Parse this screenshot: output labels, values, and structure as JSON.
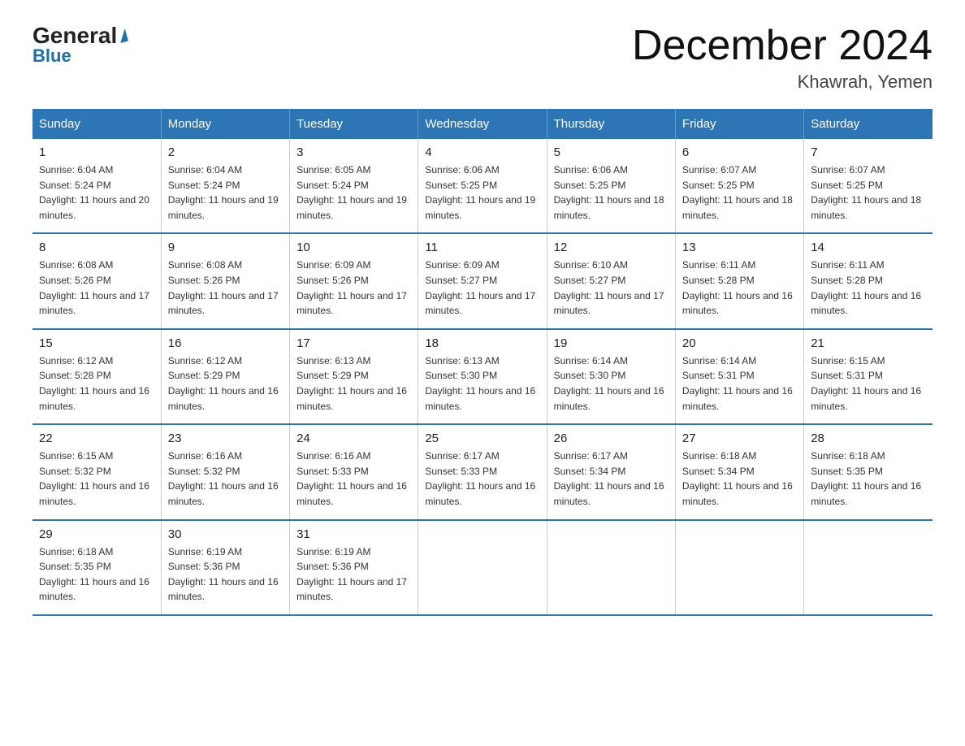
{
  "logo": {
    "general": "General",
    "blue": "Blue"
  },
  "header": {
    "title": "December 2024",
    "location": "Khawrah, Yemen"
  },
  "days_of_week": [
    "Sunday",
    "Monday",
    "Tuesday",
    "Wednesday",
    "Thursday",
    "Friday",
    "Saturday"
  ],
  "weeks": [
    [
      {
        "day": "1",
        "sunrise": "6:04 AM",
        "sunset": "5:24 PM",
        "daylight": "11 hours and 20 minutes."
      },
      {
        "day": "2",
        "sunrise": "6:04 AM",
        "sunset": "5:24 PM",
        "daylight": "11 hours and 19 minutes."
      },
      {
        "day": "3",
        "sunrise": "6:05 AM",
        "sunset": "5:24 PM",
        "daylight": "11 hours and 19 minutes."
      },
      {
        "day": "4",
        "sunrise": "6:06 AM",
        "sunset": "5:25 PM",
        "daylight": "11 hours and 19 minutes."
      },
      {
        "day": "5",
        "sunrise": "6:06 AM",
        "sunset": "5:25 PM",
        "daylight": "11 hours and 18 minutes."
      },
      {
        "day": "6",
        "sunrise": "6:07 AM",
        "sunset": "5:25 PM",
        "daylight": "11 hours and 18 minutes."
      },
      {
        "day": "7",
        "sunrise": "6:07 AM",
        "sunset": "5:25 PM",
        "daylight": "11 hours and 18 minutes."
      }
    ],
    [
      {
        "day": "8",
        "sunrise": "6:08 AM",
        "sunset": "5:26 PM",
        "daylight": "11 hours and 17 minutes."
      },
      {
        "day": "9",
        "sunrise": "6:08 AM",
        "sunset": "5:26 PM",
        "daylight": "11 hours and 17 minutes."
      },
      {
        "day": "10",
        "sunrise": "6:09 AM",
        "sunset": "5:26 PM",
        "daylight": "11 hours and 17 minutes."
      },
      {
        "day": "11",
        "sunrise": "6:09 AM",
        "sunset": "5:27 PM",
        "daylight": "11 hours and 17 minutes."
      },
      {
        "day": "12",
        "sunrise": "6:10 AM",
        "sunset": "5:27 PM",
        "daylight": "11 hours and 17 minutes."
      },
      {
        "day": "13",
        "sunrise": "6:11 AM",
        "sunset": "5:28 PM",
        "daylight": "11 hours and 16 minutes."
      },
      {
        "day": "14",
        "sunrise": "6:11 AM",
        "sunset": "5:28 PM",
        "daylight": "11 hours and 16 minutes."
      }
    ],
    [
      {
        "day": "15",
        "sunrise": "6:12 AM",
        "sunset": "5:28 PM",
        "daylight": "11 hours and 16 minutes."
      },
      {
        "day": "16",
        "sunrise": "6:12 AM",
        "sunset": "5:29 PM",
        "daylight": "11 hours and 16 minutes."
      },
      {
        "day": "17",
        "sunrise": "6:13 AM",
        "sunset": "5:29 PM",
        "daylight": "11 hours and 16 minutes."
      },
      {
        "day": "18",
        "sunrise": "6:13 AM",
        "sunset": "5:30 PM",
        "daylight": "11 hours and 16 minutes."
      },
      {
        "day": "19",
        "sunrise": "6:14 AM",
        "sunset": "5:30 PM",
        "daylight": "11 hours and 16 minutes."
      },
      {
        "day": "20",
        "sunrise": "6:14 AM",
        "sunset": "5:31 PM",
        "daylight": "11 hours and 16 minutes."
      },
      {
        "day": "21",
        "sunrise": "6:15 AM",
        "sunset": "5:31 PM",
        "daylight": "11 hours and 16 minutes."
      }
    ],
    [
      {
        "day": "22",
        "sunrise": "6:15 AM",
        "sunset": "5:32 PM",
        "daylight": "11 hours and 16 minutes."
      },
      {
        "day": "23",
        "sunrise": "6:16 AM",
        "sunset": "5:32 PM",
        "daylight": "11 hours and 16 minutes."
      },
      {
        "day": "24",
        "sunrise": "6:16 AM",
        "sunset": "5:33 PM",
        "daylight": "11 hours and 16 minutes."
      },
      {
        "day": "25",
        "sunrise": "6:17 AM",
        "sunset": "5:33 PM",
        "daylight": "11 hours and 16 minutes."
      },
      {
        "day": "26",
        "sunrise": "6:17 AM",
        "sunset": "5:34 PM",
        "daylight": "11 hours and 16 minutes."
      },
      {
        "day": "27",
        "sunrise": "6:18 AM",
        "sunset": "5:34 PM",
        "daylight": "11 hours and 16 minutes."
      },
      {
        "day": "28",
        "sunrise": "6:18 AM",
        "sunset": "5:35 PM",
        "daylight": "11 hours and 16 minutes."
      }
    ],
    [
      {
        "day": "29",
        "sunrise": "6:18 AM",
        "sunset": "5:35 PM",
        "daylight": "11 hours and 16 minutes."
      },
      {
        "day": "30",
        "sunrise": "6:19 AM",
        "sunset": "5:36 PM",
        "daylight": "11 hours and 16 minutes."
      },
      {
        "day": "31",
        "sunrise": "6:19 AM",
        "sunset": "5:36 PM",
        "daylight": "11 hours and 17 minutes."
      },
      null,
      null,
      null,
      null
    ]
  ],
  "labels": {
    "sunrise_prefix": "Sunrise: ",
    "sunset_prefix": "Sunset: ",
    "daylight_prefix": "Daylight: "
  }
}
